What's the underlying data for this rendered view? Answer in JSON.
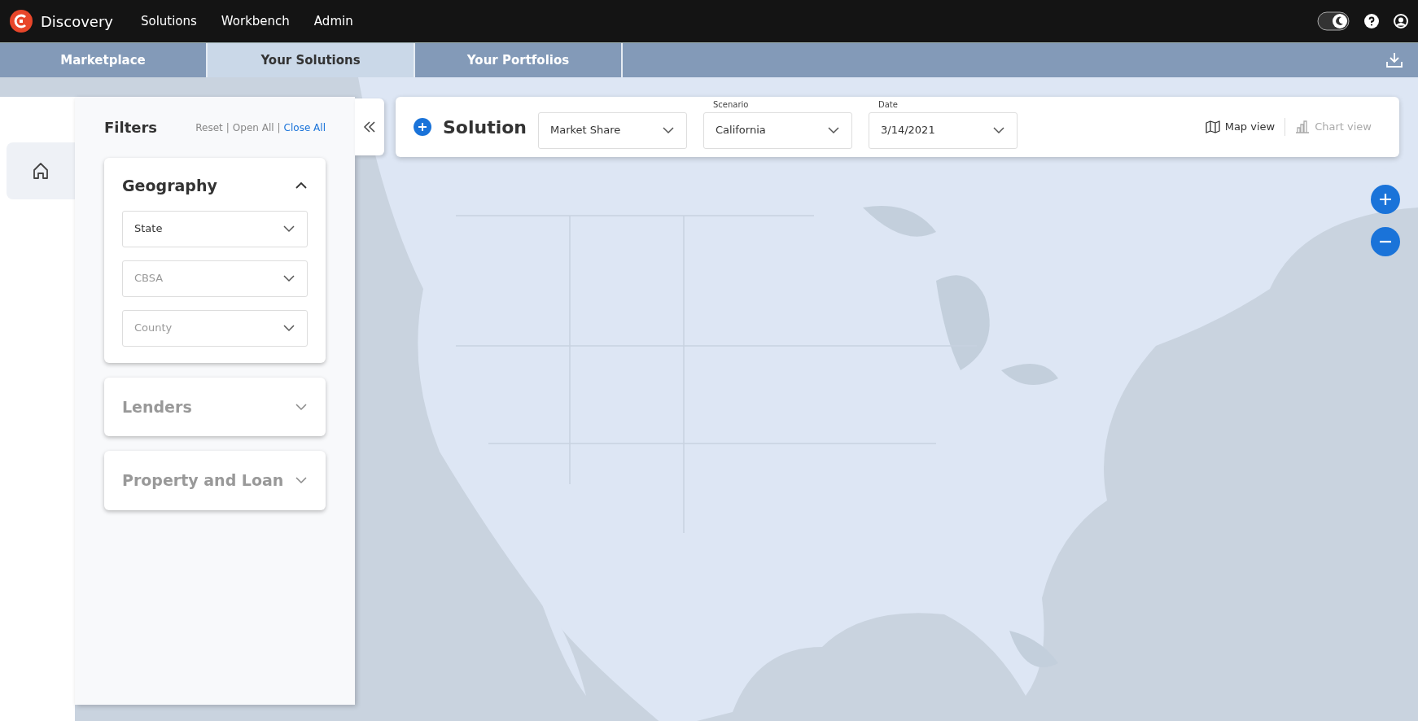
{
  "app": {
    "name": "Discovery"
  },
  "nav": [
    {
      "label": "Solutions"
    },
    {
      "label": "Workbench"
    },
    {
      "label": "Admin"
    }
  ],
  "theme_toggle": {
    "on": true
  },
  "tabs": [
    {
      "label": "Marketplace",
      "selected": false
    },
    {
      "label": "Your Solutions",
      "selected": true
    },
    {
      "label": "Your Portfolios",
      "selected": false
    }
  ],
  "sidebar": {
    "items": [
      {
        "kind": "home",
        "selected": true
      }
    ]
  },
  "filters": {
    "title": "Filters",
    "separator": "|",
    "actions": [
      {
        "label": "Reset",
        "active": false
      },
      {
        "label": "Open All",
        "active": false
      },
      {
        "label": "Close All",
        "active": true
      }
    ],
    "sections": [
      {
        "title": "Geography",
        "expanded": true,
        "fields": [
          {
            "label": "State",
            "disabled": false
          },
          {
            "label": "CBSA",
            "disabled": true
          },
          {
            "label": "County",
            "disabled": true
          }
        ]
      },
      {
        "title": "Lenders",
        "expanded": false
      },
      {
        "title": "Property and Loan",
        "expanded": false
      }
    ]
  },
  "toolbar": {
    "title": "Solution",
    "selects": [
      {
        "value": "Market Share"
      },
      {
        "label": "Scenario",
        "value": "California"
      },
      {
        "label": "Date",
        "value": "3/14/2021"
      }
    ],
    "views": [
      {
        "label": "Map view",
        "kind": "map",
        "disabled": false
      },
      {
        "label": "Chart view",
        "kind": "chart",
        "disabled": true
      }
    ]
  }
}
